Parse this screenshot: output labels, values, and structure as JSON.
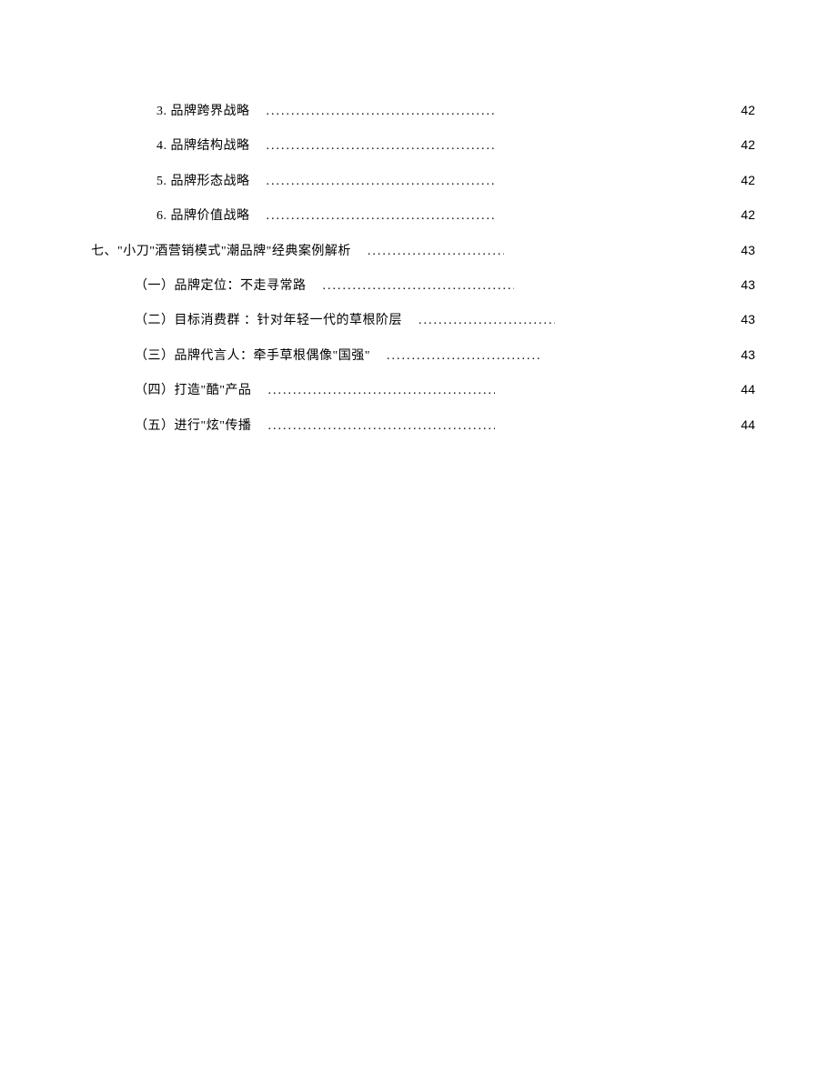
{
  "toc": [
    {
      "label": "3. 品牌跨界战略",
      "page": "42",
      "indent": 2,
      "dotsWidth": 250
    },
    {
      "label": "4. 品牌结构战略",
      "page": "42",
      "indent": 2,
      "dotsWidth": 250
    },
    {
      "label": "5. 品牌形态战略",
      "page": "42",
      "indent": 2,
      "dotsWidth": 250
    },
    {
      "label": "6. 品牌价值战略",
      "page": "42",
      "indent": 2,
      "dotsWidth": 250
    },
    {
      "label": "七、\"小刀\"酒营销模式\"潮品牌\"经典案例解析",
      "page": "43",
      "indent": 0,
      "dotsWidth": 150
    },
    {
      "label": "（一）品牌定位：不走寻常路",
      "page": "43",
      "indent": 1,
      "dotsWidth": 210
    },
    {
      "label": "（二）目标消费群 ：针对年轻一代的草根阶层",
      "page": "43",
      "indent": 1,
      "dotsWidth": 150
    },
    {
      "label": "（三）品牌代言人：牵手草根偶像\"国强\"",
      "page": "43",
      "indent": 1,
      "dotsWidth": 170
    },
    {
      "label": "（四）打造\"酷\"产品",
      "page": "44",
      "indent": 1,
      "dotsWidth": 250
    },
    {
      "label": "（五）进行\"炫\"传播",
      "page": "44",
      "indent": 1,
      "dotsWidth": 250
    }
  ]
}
